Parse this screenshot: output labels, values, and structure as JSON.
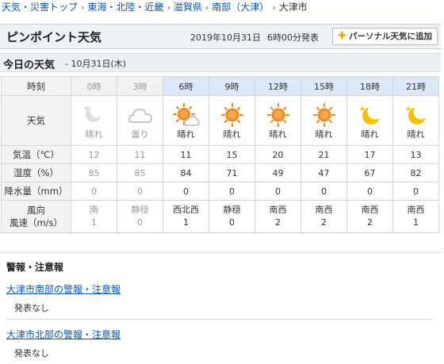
{
  "breadcrumb": {
    "items": [
      "天気・災害トップ",
      "東海・北陸・近畿",
      "滋賀県",
      "南部（大津）"
    ],
    "current": "大津市"
  },
  "header": {
    "title": "ピンポイント天気",
    "date": "2019年10月31日",
    "time": "6時00分発表",
    "add_button": "パーソナル天気に追加"
  },
  "today": {
    "title": "今日の天気",
    "date": "- 10月31日(木)"
  },
  "table": {
    "labels": {
      "time": "時刻",
      "weather": "天気",
      "temp": "気温（℃）",
      "humidity": "湿度（%）",
      "precip": "降水量（mm）",
      "wind_dir": "風向",
      "wind_speed": "風速（m/s）"
    },
    "hours": [
      "0時",
      "3時",
      "6時",
      "9時",
      "12時",
      "15時",
      "18時",
      "21時"
    ],
    "weather": [
      "晴れ",
      "曇り",
      "晴れ",
      "晴れ",
      "晴れ",
      "晴れ",
      "晴れ",
      "晴れ"
    ],
    "icons": [
      "moon-cloud-icon",
      "cloud-icon",
      "sun-cloud-icon",
      "sun-icon",
      "sun-icon",
      "sun-icon",
      "moon-icon",
      "moon-icon"
    ],
    "temp": [
      "12",
      "11",
      "11",
      "15",
      "20",
      "21",
      "17",
      "13"
    ],
    "humidity": [
      "85",
      "85",
      "84",
      "71",
      "49",
      "47",
      "67",
      "82"
    ],
    "precip": [
      "0",
      "0",
      "0",
      "0",
      "0",
      "0",
      "0",
      "0"
    ],
    "wind_dir": [
      "南",
      "静穏",
      "西北西",
      "静穏",
      "南西",
      "南西",
      "南西",
      "南西"
    ],
    "wind_speed": [
      "1",
      "0",
      "1",
      "0",
      "2",
      "2",
      "2",
      "1"
    ]
  },
  "warnings": {
    "title": "警報・注意報",
    "south_link": "大津市南部の警報・注意報",
    "south_status": "発表なし",
    "north_link": "大津市北部の警報・注意報",
    "north_status": "発表なし"
  },
  "colors": {
    "link": "#0b55b4",
    "sun": "#f08a1c",
    "moon": "#f5c000",
    "past": "#9a9a9a"
  }
}
